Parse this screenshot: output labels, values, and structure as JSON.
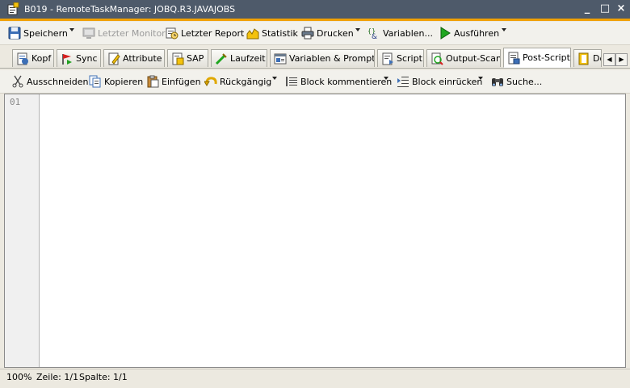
{
  "window": {
    "title": "B019 - RemoteTaskManager: JOBQ.R3.JAVAJOBS",
    "minimize": "_",
    "maximize": "□",
    "close": "×"
  },
  "toolbar": {
    "save": "Speichern",
    "last_monitor": "Letzter Monitor",
    "last_report": "Letzter Report",
    "statistics": "Statistik",
    "print": "Drucken",
    "variables": "Variablen...",
    "execute": "Ausführen"
  },
  "tabs": [
    {
      "label": "Kopf",
      "icon": "header-icon"
    },
    {
      "label": "Sync",
      "icon": "sync-flag-icon"
    },
    {
      "label": "Attribute",
      "icon": "attribute-icon"
    },
    {
      "label": "SAP",
      "icon": "sap-icon"
    },
    {
      "label": "Laufzeit",
      "icon": "runtime-icon"
    },
    {
      "label": "Variablen & Prompts",
      "icon": "variables-prompts-icon"
    },
    {
      "label": "Script",
      "icon": "script-icon"
    },
    {
      "label": "Output-Scan",
      "icon": "output-scan-icon"
    },
    {
      "label": "Post-Script",
      "icon": "post-script-icon"
    },
    {
      "label": "Do",
      "icon": "documentation-icon"
    }
  ],
  "active_tab": "Post-Script",
  "editor_toolbar": {
    "cut": "Ausschneiden",
    "copy": "Kopieren",
    "paste": "Einfügen",
    "undo": "Rückgängig",
    "comment_block": "Block kommentieren",
    "indent_block": "Block einrücken",
    "search": "Suche..."
  },
  "editor": {
    "line_numbers": [
      "01"
    ],
    "content": ""
  },
  "status": {
    "zoom": "100%",
    "line": "Zeile: 1/1",
    "column": "Spalte: 1/1"
  },
  "colors": {
    "title_bar": "#4e5a6a",
    "title_accent": "#f0a000"
  }
}
